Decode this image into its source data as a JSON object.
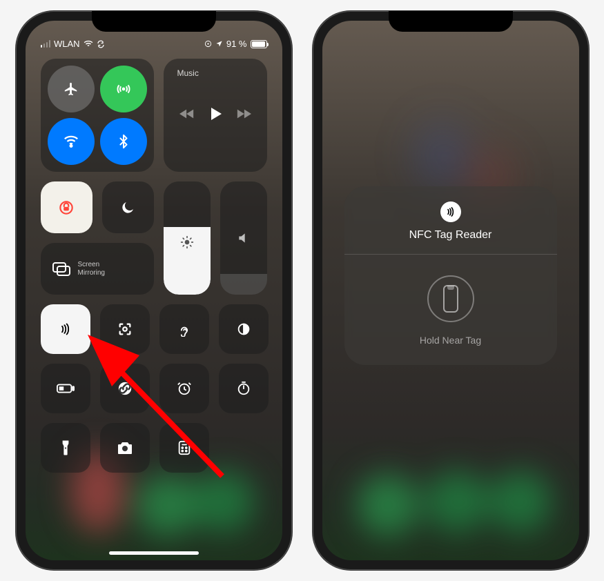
{
  "status": {
    "carrier": "WLAN",
    "battery": "91 %"
  },
  "controlCenter": {
    "connectivity": {
      "airplane": "airplane-mode",
      "cellular": "cellular-data",
      "wifi": "wifi",
      "bluetooth": "bluetooth"
    },
    "music": {
      "label": "Music"
    },
    "screenMirroring": {
      "line1": "Screen",
      "line2": "Mirroring"
    },
    "shortcutRows": [
      [
        "nfc",
        "qr-scan",
        "hearing",
        "dark-mode"
      ],
      [
        "low-power",
        "shazam",
        "alarm",
        "timer"
      ],
      [
        "flashlight",
        "camera",
        "calculator",
        ""
      ]
    ]
  },
  "nfcPanel": {
    "title": "NFC Tag Reader",
    "instruction": "Hold Near Tag"
  }
}
